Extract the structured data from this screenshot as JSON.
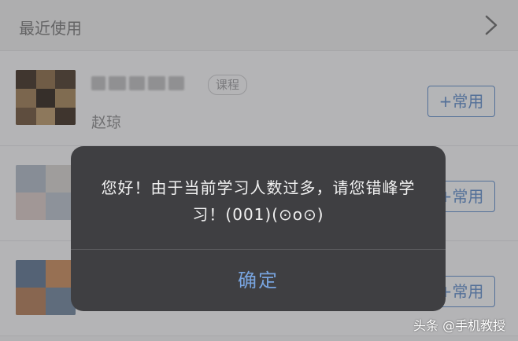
{
  "section": {
    "title": "最近使用"
  },
  "rows": [
    {
      "tag": "课程",
      "author": "赵琼",
      "button": "+常用"
    },
    {
      "button": "+常用"
    },
    {
      "button": "+常用"
    }
  ],
  "dialog": {
    "message": "您好！由于当前学习人数过多，请您错峰学习！(001)(⊙o⊙)",
    "confirm": "确定"
  },
  "watermark": "头条 @手机教授",
  "colors": {
    "accent": "#5b89c9",
    "dialog_bg": "#3f3f42",
    "confirm": "#78a4df"
  }
}
